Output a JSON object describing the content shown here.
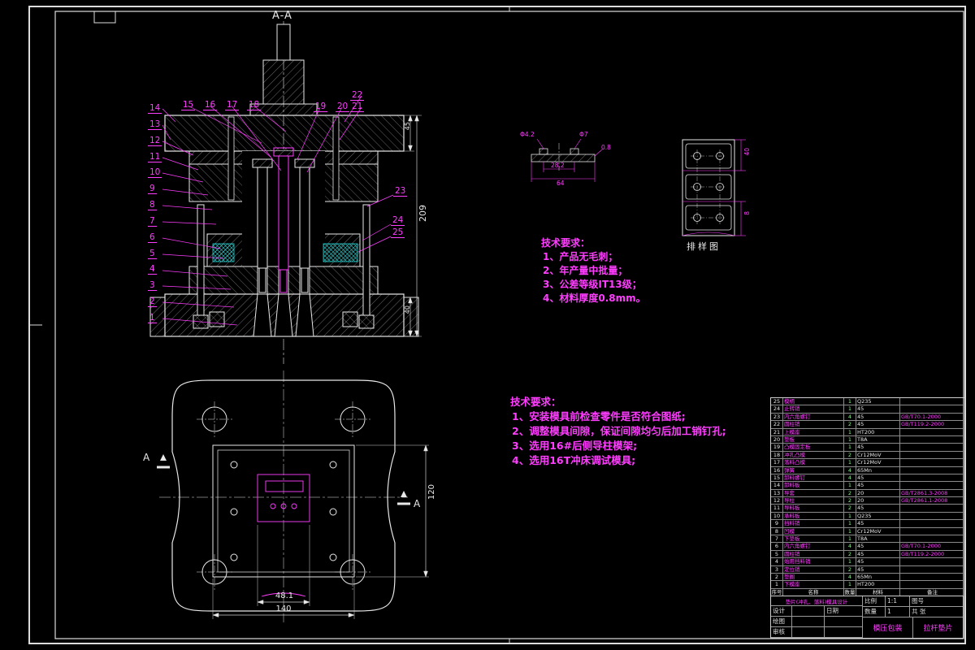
{
  "colors": {
    "background": "#000000",
    "line": "#e8e8e8",
    "accent": "#ff3dff",
    "cyan": "#27d7d7"
  },
  "section_view": {
    "title": "A-A",
    "balloons_left": [
      "14",
      "13",
      "12",
      "11",
      "10",
      "9",
      "8",
      "7",
      "6",
      "5",
      "4",
      "3",
      "2",
      "1"
    ],
    "balloons_top_a": [
      "15",
      "16",
      "17",
      "18"
    ],
    "balloons_top_b": [
      "19",
      "20"
    ],
    "balloons_top_c": [
      "22",
      "21"
    ],
    "balloons_right": [
      "23",
      "24",
      "25"
    ],
    "dim_height": "209",
    "dim_top": "45",
    "dim_bottom": "40"
  },
  "plan_view": {
    "section_mark_left": "A",
    "section_mark_right": "A",
    "dim_inner": "48.1",
    "dim_width": "140",
    "dim_height": "120"
  },
  "part_view": {
    "dim_hole": "Φ4.2",
    "dim_boss": "Φ7",
    "dim_span": "28.2",
    "dim_width": "64",
    "dim_thickness": "0.8"
  },
  "strip_view": {
    "label": "排样图",
    "dim_pitch": "40",
    "dim_margin": "8"
  },
  "tech_req_right": {
    "title": "技术要求：",
    "items": [
      "1、产品无毛刺；",
      "2、年产量中批量；",
      "3、公差等级IT13级；",
      "4、材料厚度0.8mm。"
    ]
  },
  "tech_req_mid": {
    "title": "技术要求：",
    "items": [
      "1、安装模具前检查零件是否符合图纸;",
      "2、调整模具间隙，保证间隙均匀后加工销钉孔;",
      "3、选用16#后侧导柱模架;",
      "4、选用16T冲床调试模具;"
    ]
  },
  "parts_table": {
    "headers": [
      "序号",
      "名称",
      "数量",
      "材料",
      "备注"
    ],
    "rows": [
      {
        "seq": "25",
        "name": "模柄",
        "qty": "1",
        "mat": "Q235",
        "remark": ""
      },
      {
        "seq": "24",
        "name": "止转销",
        "qty": "1",
        "mat": "45",
        "remark": ""
      },
      {
        "seq": "23",
        "name": "内六角螺钉",
        "qty": "4",
        "mat": "45",
        "remark": "GB/T70.1-2000"
      },
      {
        "seq": "22",
        "name": "圆柱销",
        "qty": "2",
        "mat": "45",
        "remark": "GB/T119.2-2000"
      },
      {
        "seq": "21",
        "name": "上模座",
        "qty": "1",
        "mat": "HT200",
        "remark": ""
      },
      {
        "seq": "20",
        "name": "垫板",
        "qty": "1",
        "mat": "T8A",
        "remark": ""
      },
      {
        "seq": "19",
        "name": "凸模固定板",
        "qty": "1",
        "mat": "45",
        "remark": ""
      },
      {
        "seq": "18",
        "name": "冲孔凸模",
        "qty": "2",
        "mat": "Cr12MoV",
        "remark": ""
      },
      {
        "seq": "17",
        "name": "落料凸模",
        "qty": "1",
        "mat": "Cr12MoV",
        "remark": ""
      },
      {
        "seq": "16",
        "name": "弹簧",
        "qty": "4",
        "mat": "65Mn",
        "remark": ""
      },
      {
        "seq": "15",
        "name": "卸料螺钉",
        "qty": "4",
        "mat": "45",
        "remark": ""
      },
      {
        "seq": "14",
        "name": "卸料板",
        "qty": "1",
        "mat": "45",
        "remark": ""
      },
      {
        "seq": "13",
        "name": "导套",
        "qty": "2",
        "mat": "20",
        "remark": "GB/T2861.3-2008"
      },
      {
        "seq": "12",
        "name": "导柱",
        "qty": "2",
        "mat": "20",
        "remark": "GB/T2861.1-2008"
      },
      {
        "seq": "11",
        "name": "导料板",
        "qty": "2",
        "mat": "45",
        "remark": ""
      },
      {
        "seq": "10",
        "name": "承料板",
        "qty": "1",
        "mat": "Q235",
        "remark": ""
      },
      {
        "seq": "9",
        "name": "挡料销",
        "qty": "1",
        "mat": "45",
        "remark": ""
      },
      {
        "seq": "8",
        "name": "凹模",
        "qty": "1",
        "mat": "Cr12MoV",
        "remark": ""
      },
      {
        "seq": "7",
        "name": "下垫板",
        "qty": "1",
        "mat": "T8A",
        "remark": ""
      },
      {
        "seq": "6",
        "name": "内六角螺钉",
        "qty": "4",
        "mat": "45",
        "remark": "GB/T70.1-2000"
      },
      {
        "seq": "5",
        "name": "圆柱销",
        "qty": "2",
        "mat": "45",
        "remark": "GB/T119.2-2000"
      },
      {
        "seq": "4",
        "name": "始用挡料销",
        "qty": "1",
        "mat": "45",
        "remark": ""
      },
      {
        "seq": "3",
        "name": "定位销",
        "qty": "2",
        "mat": "45",
        "remark": ""
      },
      {
        "seq": "2",
        "name": "垫圈",
        "qty": "4",
        "mat": "65Mn",
        "remark": ""
      },
      {
        "seq": "1",
        "name": "下模座",
        "qty": "1",
        "mat": "HT200",
        "remark": ""
      }
    ]
  },
  "title_block": {
    "project": "垫片(冲孔、落料)模具设计",
    "design_label": "设计",
    "draw_label": "绘图",
    "check_label": "审核",
    "date_label": "日期",
    "scale_label": "比例",
    "scale_value": "1:1",
    "qty_label": "数量",
    "qty_value": "1",
    "sheet_label": "共 张",
    "no_label": "图号",
    "assembly_name": "模压包装",
    "part_name": "拉杆垫片"
  }
}
